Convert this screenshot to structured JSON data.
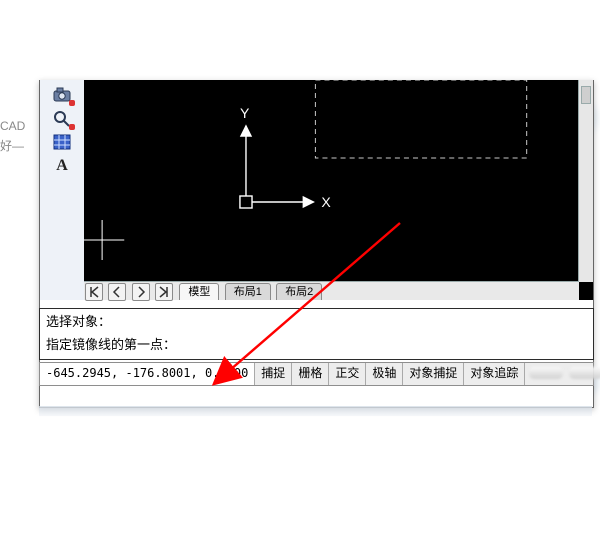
{
  "bg_text": {
    "l1": "CAD",
    "l2": "好—"
  },
  "axes": {
    "x": "X",
    "y": "Y"
  },
  "tabs": {
    "model": "模型",
    "layout1": "布局1",
    "layout2": "布局2"
  },
  "cmd": {
    "l1": "选择对象：",
    "l2": "指定镜像线的第一点："
  },
  "coords": "-645.2945, -176.8001, 0.0000",
  "status": {
    "snap": "捕捉",
    "grid": "栅格",
    "ortho": "正交",
    "polar": "极轴",
    "osnap": "对象捕捉",
    "otrack": "对象追踪"
  },
  "icons": {
    "camera": "camera-icon",
    "magnify": "loupe-icon",
    "grid": "grid-icon",
    "text": "A"
  },
  "colors": {
    "accent": "#ff0000"
  }
}
